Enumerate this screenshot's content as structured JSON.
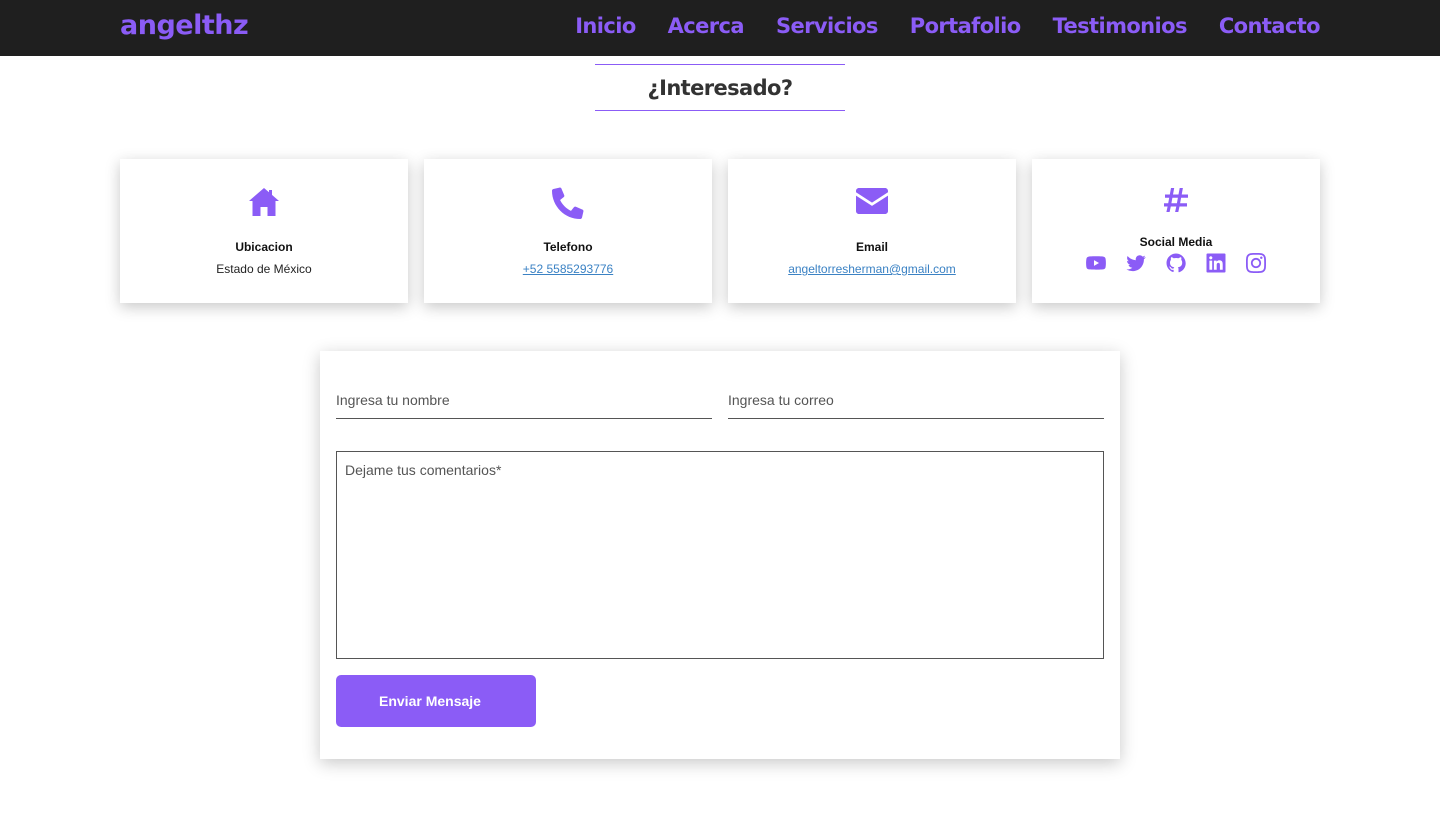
{
  "header": {
    "logo": "angelthz",
    "nav": [
      "Inicio",
      "Acerca",
      "Servicios",
      "Portafolio",
      "Testimonios",
      "Contacto"
    ]
  },
  "section": {
    "title": "¿Interesado?"
  },
  "cards": {
    "location": {
      "title": "Ubicacion",
      "text": "Estado de México",
      "icon": "home-icon"
    },
    "phone": {
      "title": "Telefono",
      "text": "+52 5585293776",
      "icon": "phone-icon"
    },
    "email": {
      "title": "Email",
      "text": "angeltorresherman@gmail.com",
      "icon": "envelope-icon"
    },
    "social": {
      "title": "Social Media",
      "icon": "hashtag-icon",
      "links": [
        "youtube-icon",
        "twitter-icon",
        "github-icon",
        "linkedin-icon",
        "instagram-icon"
      ]
    }
  },
  "form": {
    "name_placeholder": "Ingresa tu nombre",
    "email_placeholder": "Ingresa tu correo",
    "comments_placeholder": "Dejame tus comentarios*",
    "submit_label": "Enviar Mensaje"
  },
  "colors": {
    "accent": "#8b5cf6",
    "navbar": "#1f1f1f",
    "link": "#3b82c4"
  }
}
